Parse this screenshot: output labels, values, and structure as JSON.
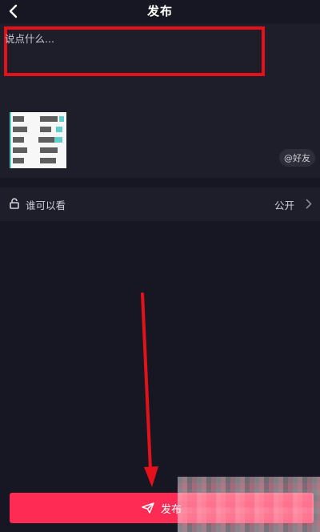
{
  "header": {
    "title": "发布",
    "back_icon": "chevron-left-icon"
  },
  "compose": {
    "placeholder": "说点什么...",
    "highlight_color": "#e5111a",
    "mention_label": "@好友"
  },
  "privacy": {
    "label": "谁可以看",
    "value": "公开",
    "icon": "lock-open-icon"
  },
  "publish": {
    "label": "发布",
    "icon": "send-icon",
    "color": "#fe2c55"
  },
  "annotation": {
    "arrow_color": "#e5111a"
  }
}
